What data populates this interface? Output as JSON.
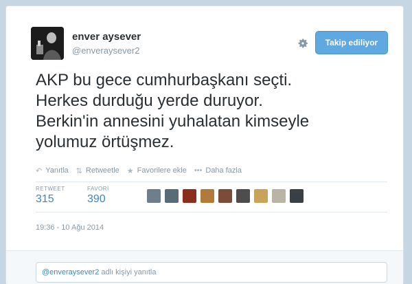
{
  "author": {
    "name": "enver aysever",
    "handle": "@enveraysever2",
    "avatar_icon": "profile-photo"
  },
  "follow_button": {
    "label": "Takip ediliyor",
    "color": "#5fa8e0"
  },
  "settings_icon": "gear-icon",
  "tweet": {
    "lines": [
      "AKP bu gece cumhurbaşkanı seçti.",
      "Herkes durduğu yerde duruyor.",
      "Berkin'in annesini yuhalatan kimseyle",
      "yolumuz örtüşmez."
    ]
  },
  "actions": [
    {
      "icon": "reply-icon",
      "label": "Yanıtla"
    },
    {
      "icon": "retweet-icon",
      "label": "Retweetle"
    },
    {
      "icon": "star-icon",
      "label": "Favorilere ekle"
    },
    {
      "icon": "more-icon",
      "label": "Daha fazla"
    }
  ],
  "stats": {
    "retweet_label": "RETWEET",
    "retweet_count": "315",
    "favorites_label": "FAVORİ",
    "favorites_count": "390"
  },
  "favoriters_avatars": [
    "#6e7f8c",
    "#5a6b78",
    "#8a2f1e",
    "#b07a3a",
    "#7c4b3a",
    "#4d4d4d",
    "#c9a35a",
    "#b8b4a6",
    "#3a3f46"
  ],
  "timestamp": "19:36 - 10 Ağu 2014",
  "reply": {
    "mention": "@enveraysever2",
    "placeholder_rest": "adlı kişiyi yanıtla"
  },
  "colors": {
    "link": "#3b88c3",
    "muted": "#8899a6",
    "text": "#292f33"
  }
}
